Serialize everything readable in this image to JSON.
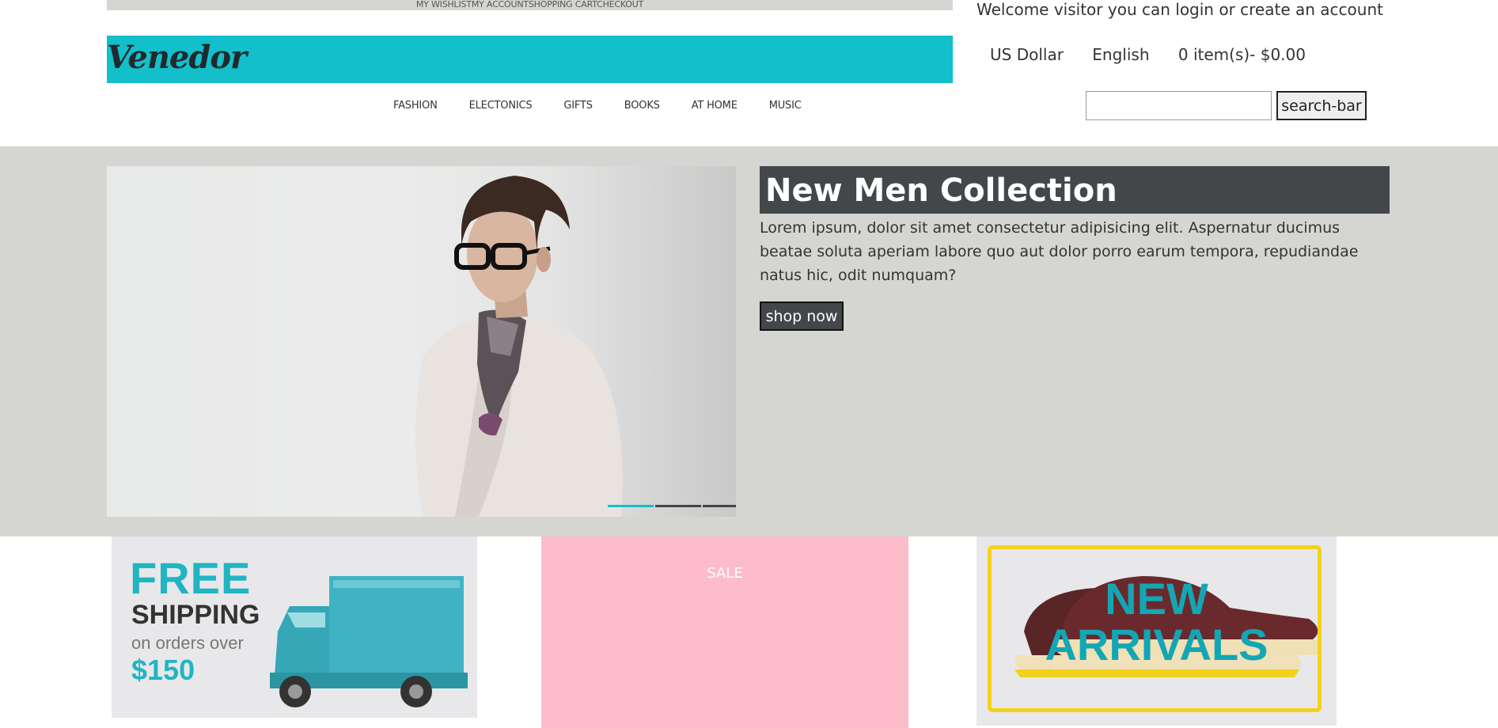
{
  "top_links": {
    "text": "MY WISHLISTMY ACCOUNTSHOPPING CARTCHECKOUT"
  },
  "header": {
    "welcome": "Welcome visitor you can login or create an account",
    "logo": "Venedor",
    "currency": "US Dollar",
    "language": "English",
    "cart": "0 item(s)- $0.00"
  },
  "nav": {
    "items": [
      "FASHION",
      "ELECTONICS",
      "GIFTS",
      "BOOKS",
      "AT HOME",
      "MUSIC"
    ]
  },
  "search": {
    "placeholder": "",
    "button_label": "search-bar"
  },
  "hero": {
    "title": "New Men Collection",
    "text": "Lorem ipsum, dolor sit amet consectetur adipisicing elit. Aspernatur ducimus beatae soluta aperiam labore quo aut dolor porro earum tempora, repudiandae natus hic, odit numquam?",
    "button_label": "shop now",
    "slides_total": 3,
    "active_slide": 1
  },
  "promos": {
    "shipping": {
      "line1": "FREE",
      "line2": "SHIPPING",
      "line3": "on orders over",
      "line4": "$150"
    },
    "sale": {
      "label": "SALE"
    },
    "new_arrivals": {
      "line1": "NEW",
      "line2": "ARRIVALS"
    }
  },
  "colors": {
    "accent": "#13bfca",
    "dark": "#434749",
    "hero_bg": "#d5d6d1",
    "sale_bg": "#fdbcc9"
  }
}
